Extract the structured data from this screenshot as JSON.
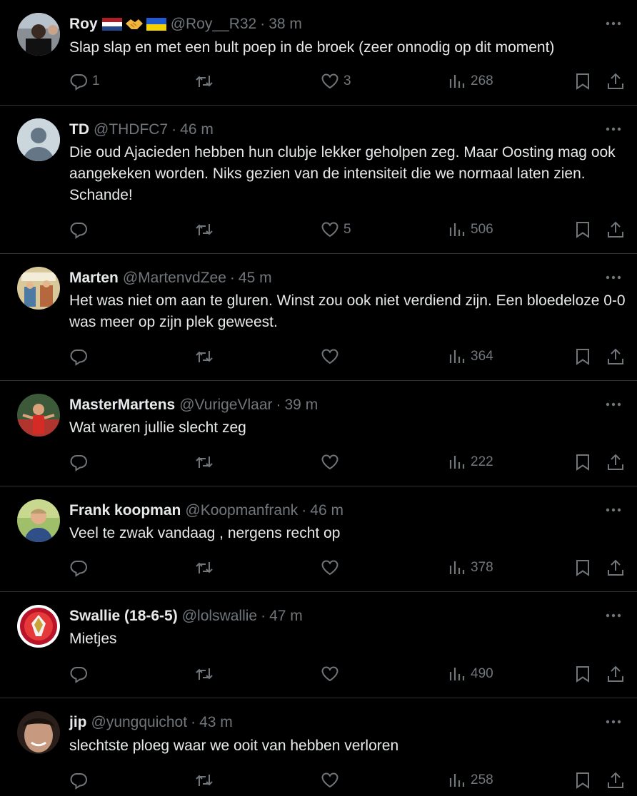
{
  "tweets": [
    {
      "name": "Roy",
      "handle": "@Roy__R32",
      "time": "38 m",
      "text": "Slap slap en met een bult poep in de broek (zeer onnodig op dit moment)",
      "replies": "1",
      "retweets": "",
      "likes": "3",
      "views": "268",
      "flags": [
        "netherlands-flag",
        "handshake",
        "ukraine-flag"
      ]
    },
    {
      "name": "TD",
      "handle": "@THDFC7",
      "time": "46 m",
      "text": "Die oud Ajacieden hebben hun clubje lekker geholpen zeg. Maar Oosting mag ook aangekeken worden. Niks gezien van de intensiteit die we normaal laten zien. Schande!",
      "replies": "",
      "retweets": "",
      "likes": "5",
      "views": "506",
      "flags": []
    },
    {
      "name": "Marten",
      "handle": "@MartenvdZee",
      "time": "45 m",
      "text": "Het was niet om aan te gluren. Winst zou ook niet verdiend zijn. Een bloedeloze 0-0 was meer op zijn plek geweest.",
      "replies": "",
      "retweets": "",
      "likes": "",
      "views": "364",
      "flags": []
    },
    {
      "name": "MasterMartens",
      "handle": "@VurigeVlaar",
      "time": "39 m",
      "text": "Wat waren jullie slecht zeg",
      "replies": "",
      "retweets": "",
      "likes": "",
      "views": "222",
      "flags": []
    },
    {
      "name": "Frank koopman",
      "handle": "@Koopmanfrank",
      "time": "46 m",
      "text": "Veel te zwak vandaag , nergens recht op",
      "replies": "",
      "retweets": "",
      "likes": "",
      "views": "378",
      "flags": []
    },
    {
      "name": "Swallie (18-6-5)",
      "handle": "@lolswallie",
      "time": "47 m",
      "text": "Mietjes",
      "replies": "",
      "retweets": "",
      "likes": "",
      "views": "490",
      "flags": []
    },
    {
      "name": "jip",
      "handle": "@yungquichot",
      "time": "43 m",
      "text": "slechtste ploeg waar we ooit van hebben verloren",
      "replies": "",
      "retweets": "",
      "likes": "",
      "views": "258",
      "flags": []
    }
  ],
  "ui": {
    "separator": "·"
  }
}
